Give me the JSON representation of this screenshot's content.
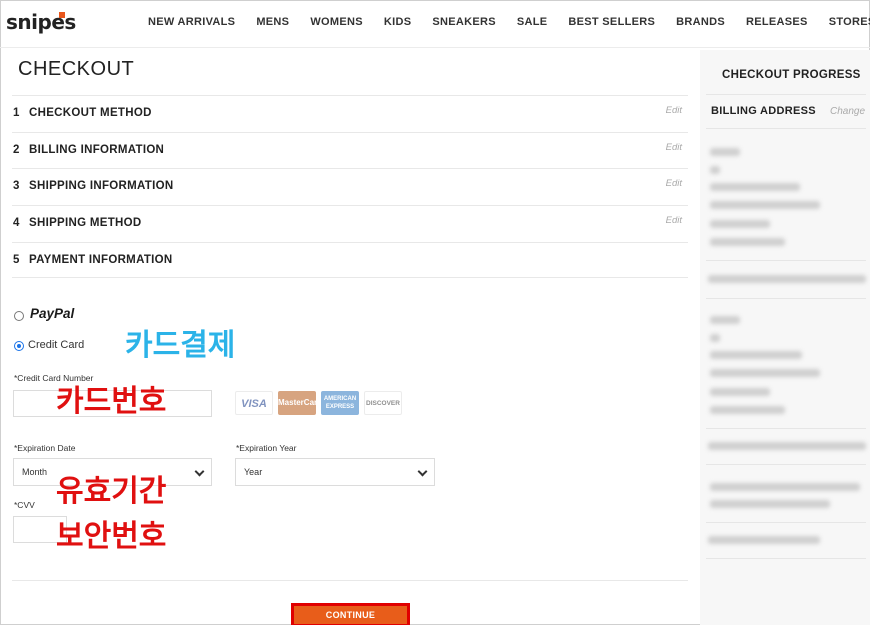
{
  "header": {
    "logo": "snipes",
    "nav": [
      "NEW ARRIVALS",
      "MENS",
      "WOMENS",
      "KIDS",
      "SNEAKERS",
      "SALE",
      "BEST SELLERS",
      "BRANDS",
      "RELEASES",
      "STORES"
    ]
  },
  "checkout": {
    "title": "CHECKOUT",
    "steps": [
      {
        "num": "1",
        "label": "CHECKOUT METHOD",
        "edit": "Edit"
      },
      {
        "num": "2",
        "label": "BILLING INFORMATION",
        "edit": "Edit"
      },
      {
        "num": "3",
        "label": "SHIPPING INFORMATION",
        "edit": "Edit"
      },
      {
        "num": "4",
        "label": "SHIPPING METHOD",
        "edit": "Edit"
      },
      {
        "num": "5",
        "label": "PAYMENT INFORMATION",
        "edit": ""
      }
    ]
  },
  "payment": {
    "paypal_label": "PayPal",
    "credit_card_label": "Credit Card",
    "card_number_label": "*Credit Card Number",
    "expiration_date_label": "*Expiration Date",
    "expiration_month_value": "Month",
    "expiration_year_label": "*Expiration Year",
    "expiration_year_value": "Year",
    "cvv_label": "*CVV",
    "cards": [
      "VISA",
      "MasterCard",
      "AMERICAN EXPRESS",
      "DISCOVER"
    ],
    "continue_label": "CONTINUE"
  },
  "annotations": {
    "card_payment": "카드결제",
    "card_number": "카드번호",
    "expiration": "유효기간",
    "security_code": "보안번호"
  },
  "sidebar": {
    "title": "CHECKOUT PROGRESS",
    "billing_label": "BILLING ADDRESS",
    "change_label": "Change"
  },
  "colors": {
    "accent": "#e8561c",
    "continue_bg": "#e85d1a",
    "highlight_border": "#e00000",
    "annotation_red": "#e01010",
    "annotation_blue": "#2bb3e8"
  }
}
